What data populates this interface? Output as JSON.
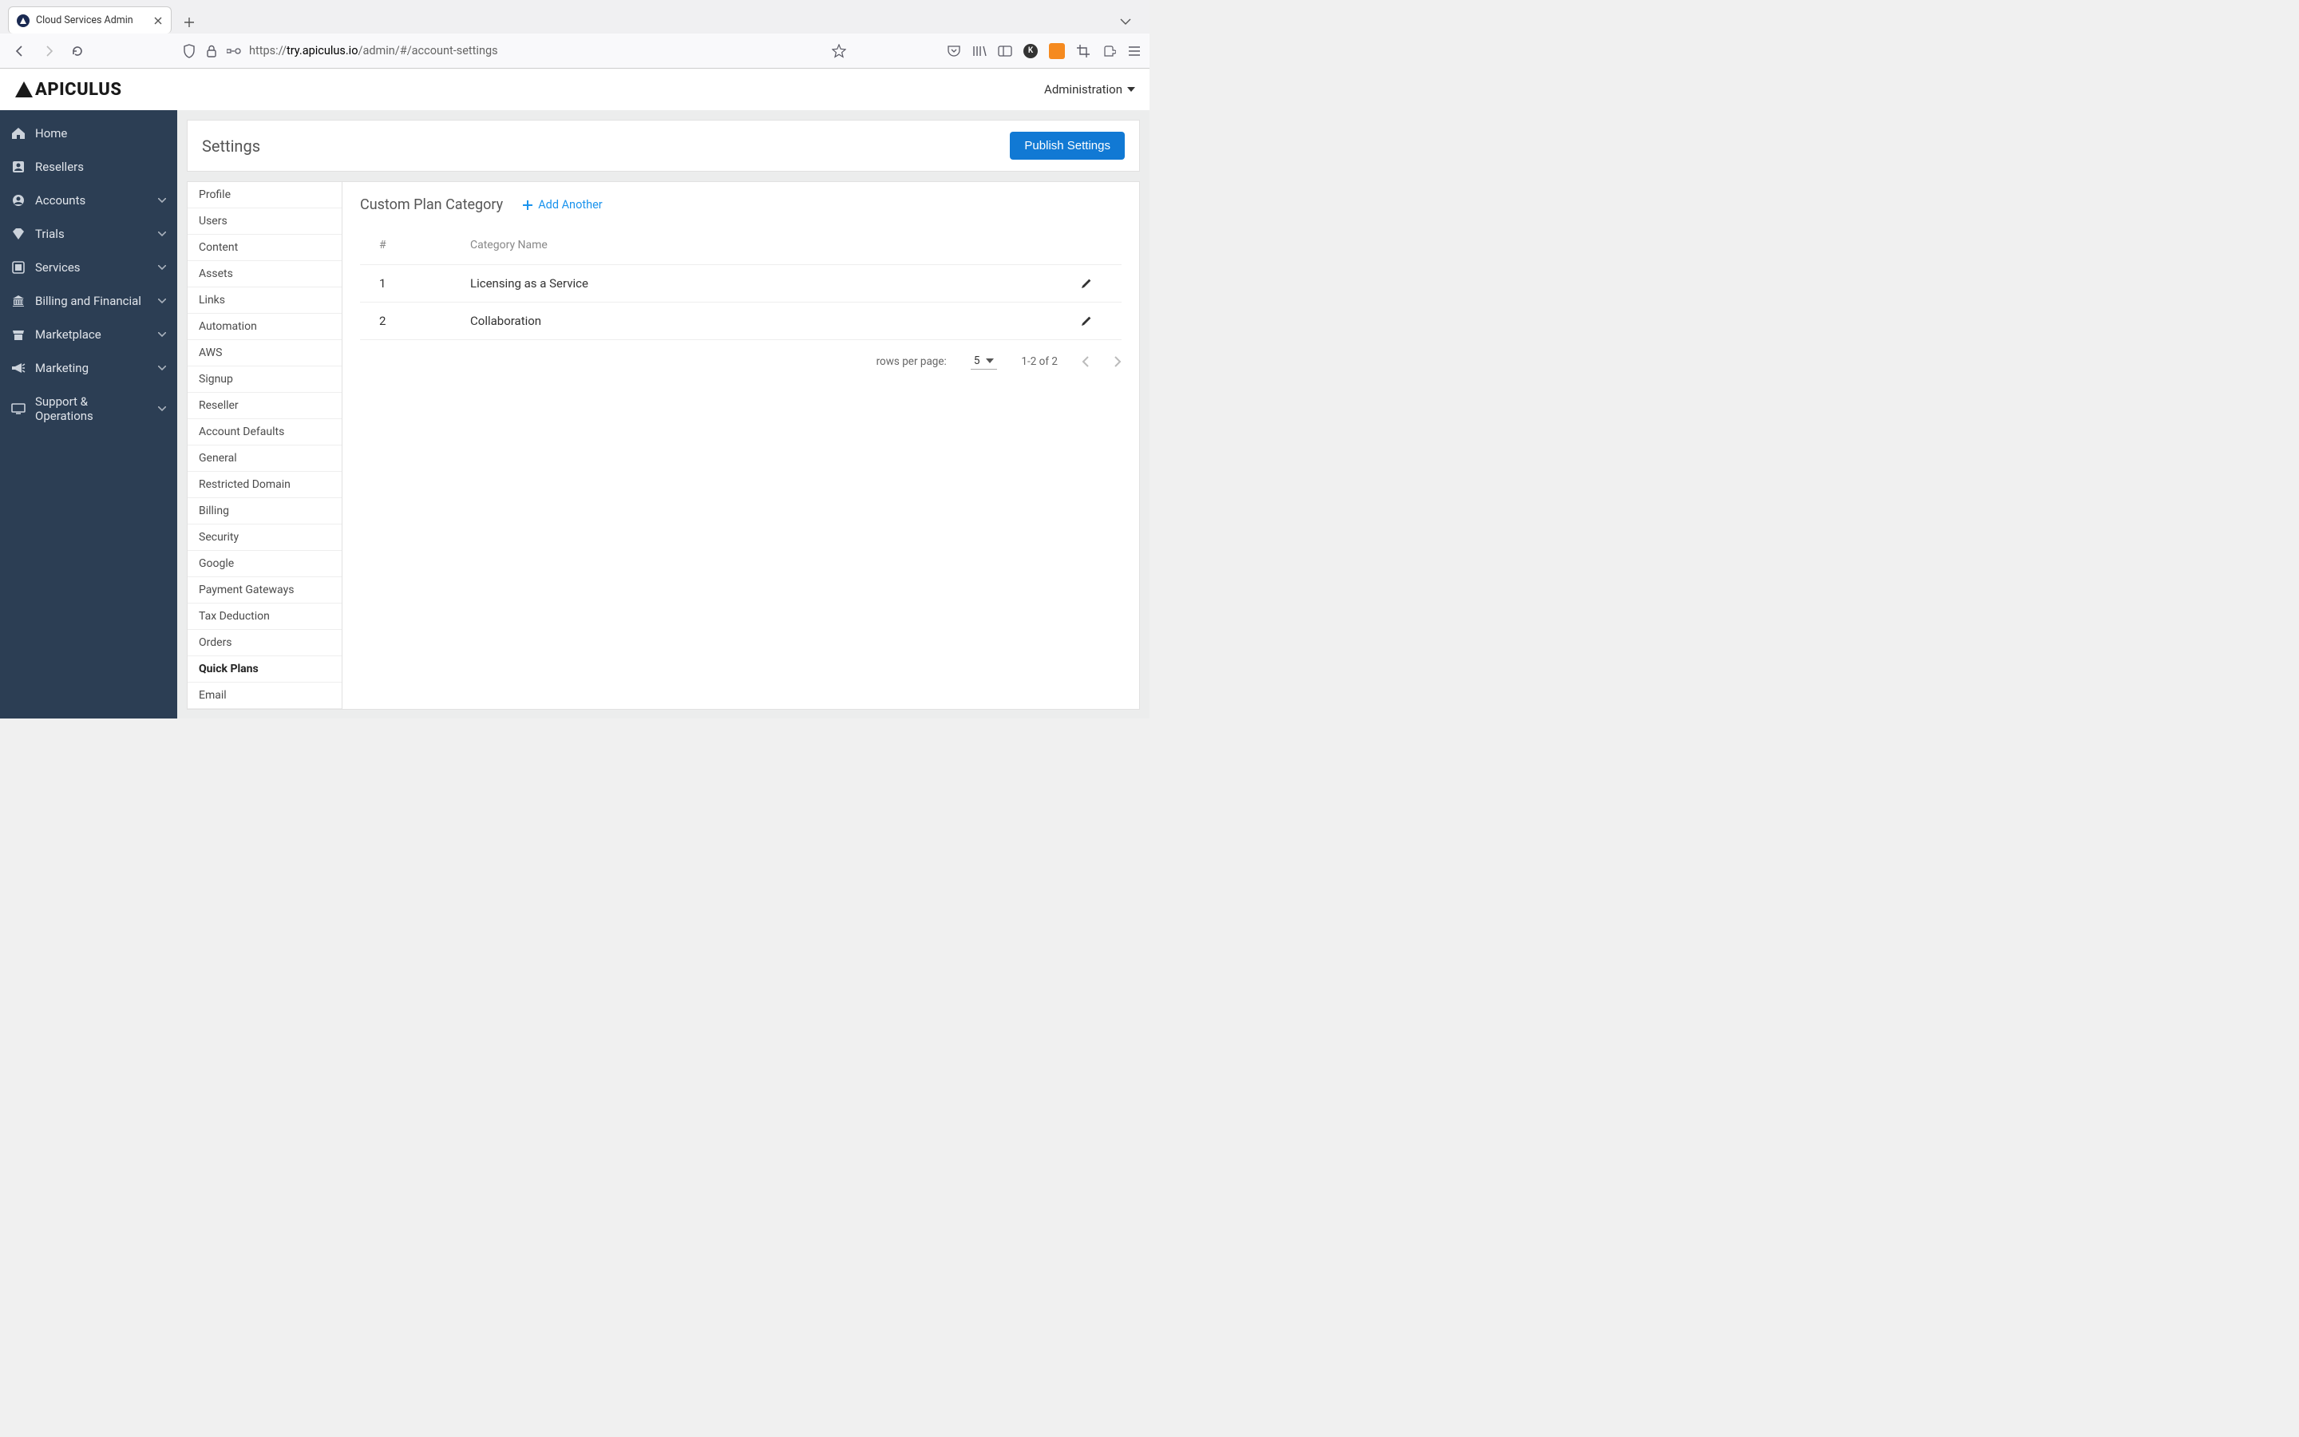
{
  "browser": {
    "tab_title": "Cloud Services Admin",
    "url_full": "https://try.apiculus.io/admin/#/account-settings",
    "url_scheme": "https://",
    "url_host": "try.apiculus.io",
    "url_path": "/admin/#/account-settings"
  },
  "header": {
    "brand": "APICULUS",
    "admin_dropdown": "Administration"
  },
  "sidebar": {
    "items": [
      {
        "label": "Home",
        "icon": "home-icon",
        "expandable": false
      },
      {
        "label": "Resellers",
        "icon": "user-badge-icon",
        "expandable": false
      },
      {
        "label": "Accounts",
        "icon": "user-circle-icon",
        "expandable": true
      },
      {
        "label": "Trials",
        "icon": "tag-icon",
        "expandable": true
      },
      {
        "label": "Services",
        "icon": "layers-icon",
        "expandable": true
      },
      {
        "label": "Billing and Financial",
        "icon": "bank-icon",
        "expandable": true
      },
      {
        "label": "Marketplace",
        "icon": "store-icon",
        "expandable": true
      },
      {
        "label": "Marketing",
        "icon": "megaphone-icon",
        "expandable": true
      },
      {
        "label": "Support & Operations",
        "icon": "monitor-icon",
        "expandable": true
      }
    ]
  },
  "content": {
    "page_title": "Settings",
    "publish_button": "Publish Settings",
    "settings_nav": [
      "Profile",
      "Users",
      "Content",
      "Assets",
      "Links",
      "Automation",
      "AWS",
      "Signup",
      "Reseller",
      "Account Defaults",
      "General",
      "Restricted Domain",
      "Billing",
      "Security",
      "Google",
      "Payment Gateways",
      "Tax Deduction",
      "Orders",
      "Quick Plans",
      "Email"
    ],
    "settings_nav_active": "Quick Plans",
    "panel": {
      "title": "Custom Plan Category",
      "add_label": "Add Another",
      "columns": {
        "index": "#",
        "name": "Category Name"
      },
      "rows": [
        {
          "index": "1",
          "name": "Licensing as a Service"
        },
        {
          "index": "2",
          "name": "Collaboration"
        }
      ],
      "pager": {
        "rows_per_page_label": "rows per page:",
        "rows_per_page_value": "5",
        "range": "1-2 of 2"
      }
    }
  }
}
